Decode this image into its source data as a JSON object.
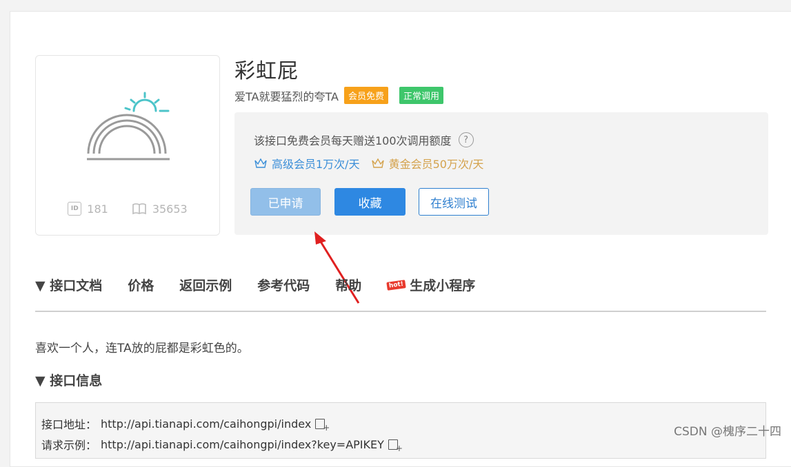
{
  "api": {
    "title": "彩虹屁",
    "subtitle": "爱TA就要猛烈的夸TA",
    "badges": [
      "会员免费",
      "正常调用"
    ],
    "id": "181",
    "views": "35653"
  },
  "panel": {
    "free_text": "该接口免费会员每天赠送100次调用额度",
    "help_symbol": "?",
    "members": [
      {
        "label": "高级会员1万次/天",
        "icon": "crown-outline-icon",
        "color": "#3a8ed8"
      },
      {
        "label": "黄金会员50万次/天",
        "icon": "crown-gold-icon",
        "color": "#d4a24c"
      }
    ],
    "buttons": {
      "applied": "已申请",
      "collect": "收藏",
      "test": "在线测试"
    }
  },
  "tabs": [
    {
      "label": "▼ 接口文档"
    },
    {
      "label": "价格"
    },
    {
      "label": "返回示例"
    },
    {
      "label": "参考代码"
    },
    {
      "label": "帮助"
    },
    {
      "label": "生成小程序",
      "icon": "hot-icon",
      "icon_text": "hot!"
    }
  ],
  "description": "喜欢一个人，连TA放的屁都是彩虹色的。",
  "section": {
    "title": "▼ 接口信息"
  },
  "api_info": {
    "address_label": "接口地址：",
    "address_value": "http://api.tianapi.com/caihongpi/index",
    "example_label": "请求示例：",
    "example_value": "http://api.tianapi.com/caihongpi/index?key=APIKEY"
  },
  "watermark": "CSDN @槐序二十四",
  "colors": {
    "primary": "#2e88e2",
    "badge_orange": "#f7a11a",
    "badge_green": "#3ec66b",
    "arrow": "#e02020"
  }
}
